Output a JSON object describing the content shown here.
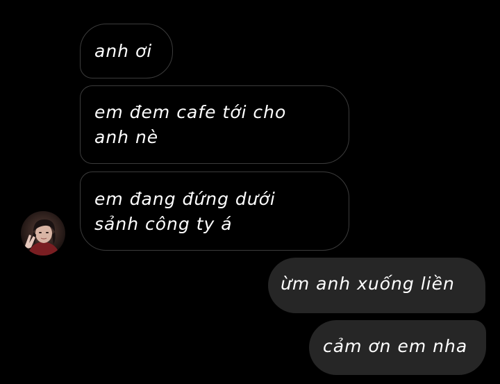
{
  "conversation": {
    "incoming": [
      {
        "text": "anh ơi"
      },
      {
        "text": "em đem cafe tới cho\nanh nè"
      },
      {
        "text": "em đang đứng dưới\nsảnh công ty á"
      }
    ],
    "outgoing": [
      {
        "text": "ừm anh xuống liền"
      },
      {
        "text": "cảm ơn em nha"
      }
    ]
  },
  "colors": {
    "background": "#000000",
    "incoming_bubble_border": "#3c3c3c",
    "outgoing_bubble": "#262626",
    "text": "#ffffff"
  },
  "avatar": {
    "icon": "contact-avatar-photo"
  }
}
